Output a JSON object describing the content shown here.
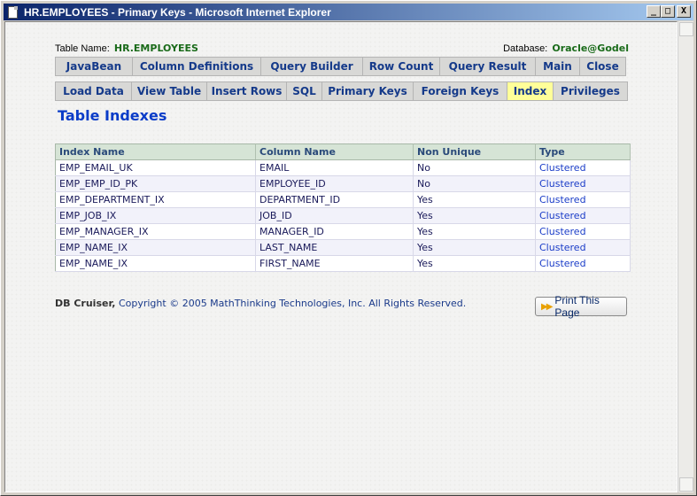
{
  "window": {
    "title": "HR.EMPLOYEES - Primary Keys - Microsoft Internet Explorer",
    "minimize_glyph": "_",
    "maximize_glyph": "□",
    "close_glyph": "X"
  },
  "meta": {
    "table_label": "Table Name:",
    "table_value": "HR.EMPLOYEES",
    "db_label": "Database:",
    "db_value": "Oracle@Godel"
  },
  "tabs_row1": [
    "JavaBean",
    "Column Definitions",
    "Query Builder",
    "Row Count",
    "Query Result",
    "Main",
    "Close"
  ],
  "tabs_row2": [
    "Load Data",
    "View Table",
    "Insert Rows",
    "SQL",
    "Primary Keys",
    "Foreign Keys",
    "Index",
    "Privileges"
  ],
  "active_tab": "Index",
  "heading": "Table Indexes",
  "table": {
    "columns": [
      "Index Name",
      "Column Name",
      "Non Unique",
      "Type"
    ],
    "rows": [
      [
        "EMP_EMAIL_UK",
        "EMAIL",
        "No",
        "Clustered"
      ],
      [
        "EMP_EMP_ID_PK",
        "EMPLOYEE_ID",
        "No",
        "Clustered"
      ],
      [
        "EMP_DEPARTMENT_IX",
        "DEPARTMENT_ID",
        "Yes",
        "Clustered"
      ],
      [
        "EMP_JOB_IX",
        "JOB_ID",
        "Yes",
        "Clustered"
      ],
      [
        "EMP_MANAGER_IX",
        "MANAGER_ID",
        "Yes",
        "Clustered"
      ],
      [
        "EMP_NAME_IX",
        "LAST_NAME",
        "Yes",
        "Clustered"
      ],
      [
        "EMP_NAME_IX",
        "FIRST_NAME",
        "Yes",
        "Clustered"
      ]
    ]
  },
  "footer": {
    "brand": "DB Cruiser,",
    "copyright": "Copyright © 2005 MathThinking Technologies, Inc.  All Rights Reserved.",
    "print_label": "Print This Page",
    "print_icon": "double-arrow-icon"
  },
  "colors": {
    "title_gradient_start": "#0a246a",
    "accent_green": "#1a6b1a",
    "active_tab": "#ffff99",
    "heading": "#0a3cc8"
  }
}
